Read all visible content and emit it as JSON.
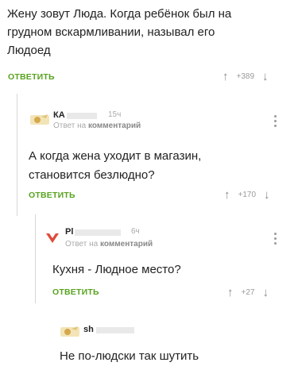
{
  "comment1": {
    "text_lines": [
      "Жену зовут Люда. Когда ребёнок был на",
      "грудном вскармливании, называл его",
      "Людоед"
    ],
    "reply_label": "ОТВЕТИТЬ",
    "score": "+389"
  },
  "comment2": {
    "username": "КА",
    "time": "15ч",
    "reply_to_prefix": "Ответ на",
    "reply_to_target": "комментарий",
    "text_lines": [
      "А когда жена уходит в магазин,",
      "становится безлюдно?"
    ],
    "reply_label": "ОТВЕТИТЬ",
    "score": "+170"
  },
  "comment3": {
    "username": "Pl",
    "time": "6ч",
    "reply_to_prefix": "Ответ на",
    "reply_to_target": "комментарий",
    "text_lines": [
      "Кухня - Людное место?"
    ],
    "reply_label": "ОТВЕТИТЬ",
    "score": "+27"
  },
  "comment4": {
    "username": "sh",
    "text_lines": [
      "Не по-людски так шутить"
    ]
  },
  "icons": {
    "upvote": "arrow-up-icon",
    "downvote": "arrow-down-icon",
    "menu": "more-vertical-icon",
    "avatar": "user-avatar-icon"
  },
  "colors": {
    "reply_link": "#58a31f",
    "muted": "#aaaaaa",
    "text": "#222222"
  }
}
